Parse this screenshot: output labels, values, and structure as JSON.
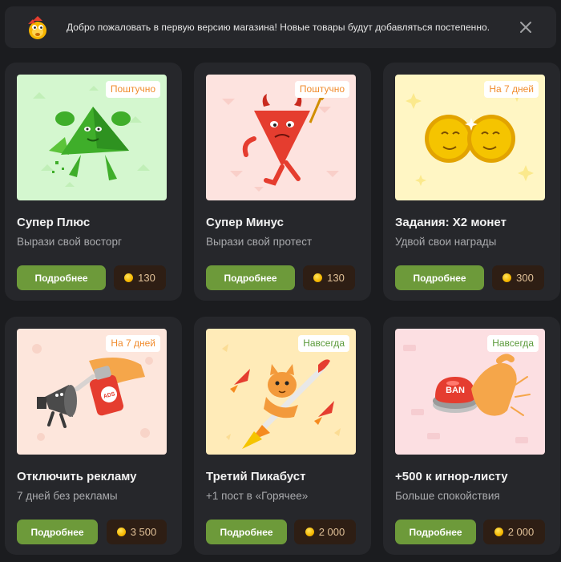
{
  "banner": {
    "text": "Добро пожаловать в первую версию магазина! Новые товары будут добавляться постепенно.",
    "mascot_icon": "pikabu-mascot-icon",
    "close_icon": "close-icon"
  },
  "colors": {
    "background": "#1b1c1f",
    "card": "#26272b",
    "button_green": "#6d9a3a",
    "price_bg": "#2e1e14",
    "badge_orange": "#f08c2e",
    "badge_green": "#5a9a3a"
  },
  "products": [
    {
      "title": "Супер Плюс",
      "subtitle": "Вырази свой восторг",
      "badge": "Поштучно",
      "button": "Подробнее",
      "price": "130"
    },
    {
      "title": "Супер Минус",
      "subtitle": "Вырази свой протест",
      "badge": "Поштучно",
      "button": "Подробнее",
      "price": "130"
    },
    {
      "title": "Задания: X2 монет",
      "subtitle": "Удвой свои награды",
      "badge": "На 7 дней",
      "button": "Подробнее",
      "price": "300"
    },
    {
      "title": "Отключить рекламу",
      "subtitle": "7 дней без рекламы",
      "badge": "На 7 дней",
      "button": "Подробнее",
      "price": "3 500"
    },
    {
      "title": "Третий Пикабуст",
      "subtitle": "+1 пост в «Горячее»",
      "badge": "Навсегда",
      "button": "Подробнее",
      "price": "2 000"
    },
    {
      "title": "+500 к игнор-листу",
      "subtitle": "Больше спокойствия",
      "badge": "Навсегда",
      "button": "Подробнее",
      "price": "2 000"
    }
  ],
  "illustrations": {
    "ads_stamp": "ADS",
    "ban_button": "BAN"
  }
}
